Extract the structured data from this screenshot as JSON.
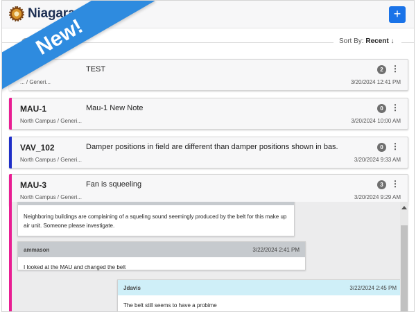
{
  "header": {
    "brand": "Niagara",
    "add_label": "+"
  },
  "ribbon": {
    "label": "New!"
  },
  "sort": {
    "prefix": "Sort By: ",
    "value": "Recent",
    "arrow": "↓"
  },
  "cards": [
    {
      "name": "",
      "desc": "TEST",
      "loc": "... / Generi...",
      "count": "2",
      "time": "3/20/2024 12:41 PM",
      "color": "#f7f7f8"
    },
    {
      "name": "MAU-1",
      "desc": "Mau-1 New Note",
      "loc": "North Campus / Generi...",
      "count": "0",
      "time": "3/20/2024 10:00 AM",
      "color": "#e91e93"
    },
    {
      "name": "VAV_102",
      "desc": "Damper positions in field are different than damper positions shown in bas.",
      "loc": "North Campus / Generi...",
      "count": "0",
      "time": "3/20/2024 9:33 AM",
      "color": "#1f2fc8"
    },
    {
      "name": "MAU-3",
      "desc": "Fan is squeeling",
      "loc": "North Campus / Generi...",
      "count": "3",
      "time": "3/20/2024 9:29 AM",
      "color": "#e91e93"
    }
  ],
  "menu_glyph": "⋮",
  "thread": {
    "messages": [
      {
        "author": "",
        "time": "",
        "body": "Neighboring buildings are complaining of a squeling sound seemingly produced by the belt for this make up air unit. Someone please investigate."
      },
      {
        "author": "ammason",
        "time": "3/22/2024 2:41 PM",
        "body": "I looked at the MAU and changed the belt"
      },
      {
        "author": "Jdavis",
        "time": "3/22/2024 2:45 PM",
        "body": "The belt still seems to have a probime"
      }
    ]
  }
}
